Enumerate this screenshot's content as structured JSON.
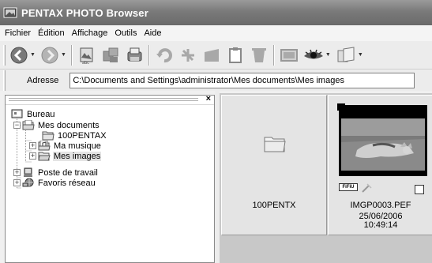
{
  "window": {
    "title": "PENTAX PHOTO Browser"
  },
  "menu": [
    "Fichier",
    "Édition",
    "Affichage",
    "Outils",
    "Aide"
  ],
  "toolbar": {
    "icons": [
      "back-icon",
      "forward-icon",
      "rename-icon",
      "copy-to-icon",
      "print-icon",
      "rotate-icon",
      "edit-icon",
      "folder-new-icon",
      "properties-icon",
      "delete-icon",
      "slideshow-icon",
      "view-icon",
      "launch-icon"
    ]
  },
  "address": {
    "label": "Adresse",
    "value": "C:\\Documents and Settings\\administrator\\Mes documents\\Mes images"
  },
  "tree": {
    "items": [
      {
        "label": "Bureau",
        "icon": "desktop-icon",
        "level": 0,
        "expander": ""
      },
      {
        "label": "Mes documents",
        "icon": "folder-open-icon",
        "level": 1,
        "expander": "−"
      },
      {
        "label": "100PENTAX",
        "icon": "folder-icon",
        "level": 2,
        "expander": ""
      },
      {
        "label": "Ma musique",
        "icon": "music-folder-icon",
        "level": 2,
        "expander": "+"
      },
      {
        "label": "Mes images",
        "icon": "folder-open-icon",
        "level": 2,
        "expander": "+",
        "selected": true
      },
      {
        "label": "Poste de travail",
        "icon": "computer-icon",
        "level": 0,
        "expander": "+"
      },
      {
        "label": "Favoris réseau",
        "icon": "network-icon",
        "level": 0,
        "expander": "+"
      }
    ]
  },
  "thumbnails": {
    "folder_tile": {
      "name": "100PENTX",
      "icon": "folder-icon"
    },
    "image_tile": {
      "name": "IMGP0003.PEF",
      "date": "25/06/2006",
      "time": "10:49:14",
      "badge": "FiFiU",
      "checked": false
    }
  }
}
